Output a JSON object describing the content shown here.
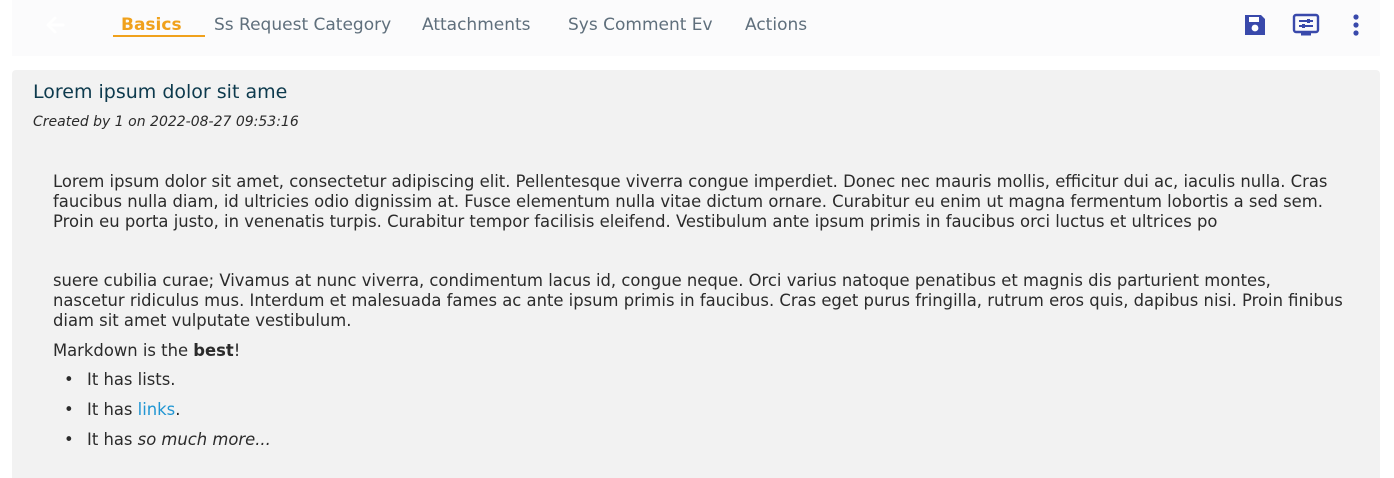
{
  "tabs": [
    {
      "label": "Basics",
      "active": true
    },
    {
      "label": "Ss Request Category"
    },
    {
      "label": "Attachments"
    },
    {
      "label": "Sys Comment Ev"
    },
    {
      "label": "Actions"
    }
  ],
  "toolbar": {
    "icons": [
      "back-arrow-icon",
      "save-icon",
      "settings-panel-icon",
      "more-vertical-icon"
    ]
  },
  "colors": {
    "active_tab": "#f0a11c",
    "icon_blue": "#3949ab",
    "title": "#0d3a4d",
    "link": "#2196d3"
  },
  "record": {
    "title": "Lorem ipsum dolor sit ame",
    "created": "Created by 1 on 2022-08-27 09:53:16",
    "para1": "Lorem ipsum dolor sit amet, consectetur adipiscing elit. Pellentesque viverra congue imperdiet. Donec nec mauris mollis, efficitur dui ac, iaculis nulla. Cras faucibus nulla diam, id ultricies odio dignissim at. Fusce elementum nulla vitae dictum ornare. Curabitur eu enim ut magna fermentum lobortis a sed sem. Proin eu porta justo, in venenatis turpis. Curabitur tempor facilisis eleifend. Vestibulum ante ipsum primis in faucibus orci luctus et ultrices po",
    "para2": "suere cubilia curae; Vivamus at nunc viverra, condimentum lacus id, congue neque. Orci varius natoque penatibus et magnis dis parturient montes, nascetur ridiculus mus. Interdum et malesuada fames ac ante ipsum primis in faucibus. Cras eget purus fringilla, rutrum eros quis, dapibus nisi. Proin finibus diam sit amet vulputate vestibulum.",
    "md_prefix": "Markdown is the ",
    "md_bold": "best",
    "md_suffix": "!",
    "bullet": "•",
    "list1": "It has lists.",
    "list2_prefix": "It has ",
    "list2_link": "links",
    "list2_suffix": ".",
    "list3_prefix": "It has ",
    "list3_italic": "so much more..."
  }
}
